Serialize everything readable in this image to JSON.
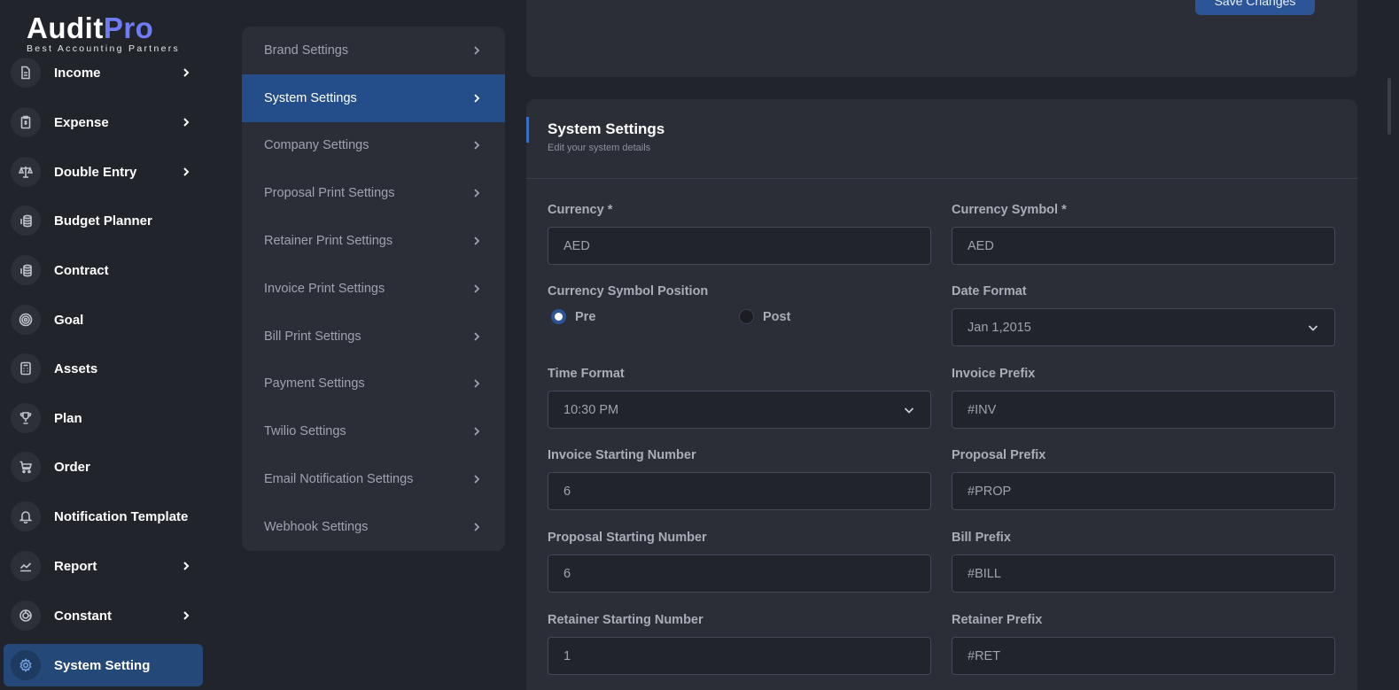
{
  "brand": {
    "name_a": "Audit",
    "name_b": "Pro",
    "tagline": "Best Accounting Partners"
  },
  "sidebar": {
    "items": [
      {
        "label": "Income",
        "icon": "file-icon",
        "chevron": true
      },
      {
        "label": "Expense",
        "icon": "receipt-icon",
        "chevron": true
      },
      {
        "label": "Double Entry",
        "icon": "scale-icon",
        "chevron": true
      },
      {
        "label": "Budget Planner",
        "icon": "coins-icon",
        "chevron": false
      },
      {
        "label": "Contract",
        "icon": "coins-icon",
        "chevron": false
      },
      {
        "label": "Goal",
        "icon": "target-icon",
        "chevron": false
      },
      {
        "label": "Assets",
        "icon": "calculator-icon",
        "chevron": false
      },
      {
        "label": "Plan",
        "icon": "trophy-icon",
        "chevron": false
      },
      {
        "label": "Order",
        "icon": "cart-icon",
        "chevron": false
      },
      {
        "label": "Notification Template",
        "icon": "bell-icon",
        "chevron": false
      },
      {
        "label": "Report",
        "icon": "chart-line-icon",
        "chevron": true
      },
      {
        "label": "Constant",
        "icon": "spiral-icon",
        "chevron": true
      },
      {
        "label": "System Setting",
        "icon": "gear-icon",
        "chevron": false,
        "active": true
      }
    ]
  },
  "settings_menu": {
    "items": [
      {
        "label": "Brand Settings"
      },
      {
        "label": "System Settings",
        "active": true
      },
      {
        "label": "Company Settings"
      },
      {
        "label": "Proposal Print Settings"
      },
      {
        "label": "Retainer Print Settings"
      },
      {
        "label": "Invoice Print Settings"
      },
      {
        "label": "Bill Print Settings"
      },
      {
        "label": "Payment Settings"
      },
      {
        "label": "Twilio Settings"
      },
      {
        "label": "Email Notification Settings"
      },
      {
        "label": "Webhook Settings"
      }
    ]
  },
  "toolbar": {
    "save_label": "Save Changes"
  },
  "card": {
    "title": "System Settings",
    "subtitle": "Edit your system details"
  },
  "form": {
    "currency": {
      "label": "Currency *",
      "value": "AED"
    },
    "currency_symbol": {
      "label": "Currency Symbol *",
      "value": "AED"
    },
    "currency_symbol_position": {
      "label": "Currency Symbol Position",
      "options": [
        "Pre",
        "Post"
      ],
      "selected": "Pre"
    },
    "date_format": {
      "label": "Date Format",
      "value": "Jan 1,2015"
    },
    "time_format": {
      "label": "Time Format",
      "value": "10:30 PM"
    },
    "invoice_prefix": {
      "label": "Invoice Prefix",
      "value": "#INV"
    },
    "invoice_starting_number": {
      "label": "Invoice Starting Number",
      "value": "6"
    },
    "proposal_prefix": {
      "label": "Proposal Prefix",
      "value": "#PROP"
    },
    "proposal_starting_number": {
      "label": "Proposal Starting Number",
      "value": "6"
    },
    "bill_prefix": {
      "label": "Bill Prefix",
      "value": "#BILL"
    },
    "retainer_starting_number": {
      "label": "Retainer Starting Number",
      "value": "1"
    },
    "retainer_prefix": {
      "label": "Retainer Prefix",
      "value": "#RET"
    }
  },
  "colors": {
    "accent": "#244e8a",
    "brand_pro": "#6f7cf5",
    "background": "#22242c",
    "card": "#2c2e37"
  }
}
